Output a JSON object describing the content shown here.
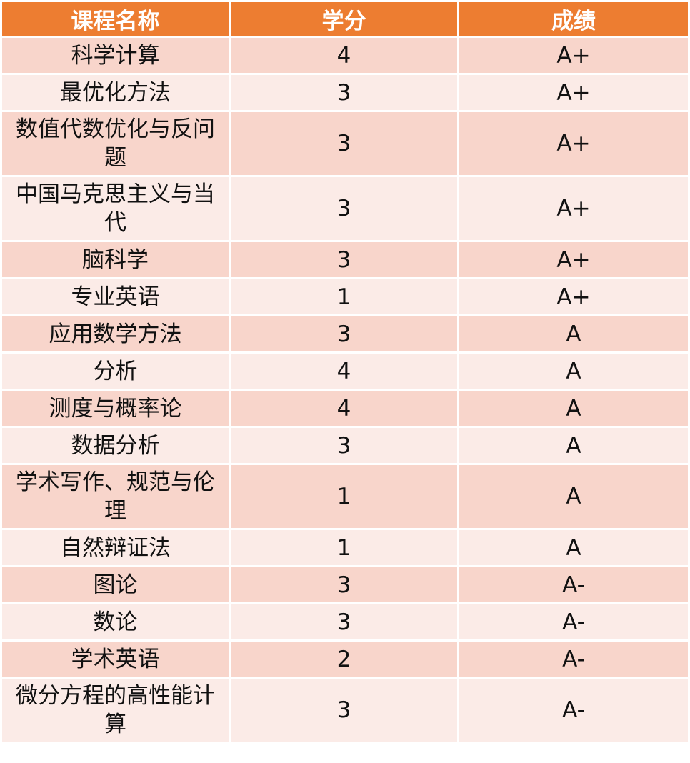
{
  "table": {
    "headers": {
      "course": "课程名称",
      "credits": "学分",
      "grade": "成绩"
    },
    "rows": [
      {
        "course": "科学计算",
        "credits": "4",
        "grade": "A+"
      },
      {
        "course": "最优化方法",
        "credits": "3",
        "grade": "A+"
      },
      {
        "course": "数值代数优化与反问题",
        "credits": "3",
        "grade": "A+"
      },
      {
        "course": "中国马克思主义与当代",
        "credits": "3",
        "grade": "A+"
      },
      {
        "course": "脑科学",
        "credits": "3",
        "grade": "A+"
      },
      {
        "course": "专业英语",
        "credits": "1",
        "grade": "A+"
      },
      {
        "course": "应用数学方法",
        "credits": "3",
        "grade": "A"
      },
      {
        "course": "分析",
        "credits": "4",
        "grade": "A"
      },
      {
        "course": "测度与概率论",
        "credits": "4",
        "grade": "A"
      },
      {
        "course": "数据分析",
        "credits": "3",
        "grade": "A"
      },
      {
        "course": "学术写作、规范与伦理",
        "credits": "1",
        "grade": "A"
      },
      {
        "course": "自然辩证法",
        "credits": "1",
        "grade": "A"
      },
      {
        "course": "图论",
        "credits": "3",
        "grade": "A-"
      },
      {
        "course": "数论",
        "credits": "3",
        "grade": "A-"
      },
      {
        "course": "学术英语",
        "credits": "2",
        "grade": "A-"
      },
      {
        "course": "微分方程的高性能计算",
        "credits": "3",
        "grade": "A-"
      }
    ]
  },
  "colors": {
    "header_bg": "#ed7d31",
    "header_text": "#ffffff",
    "row_dark": "#f8d5cb",
    "row_light": "#fbebe7"
  }
}
